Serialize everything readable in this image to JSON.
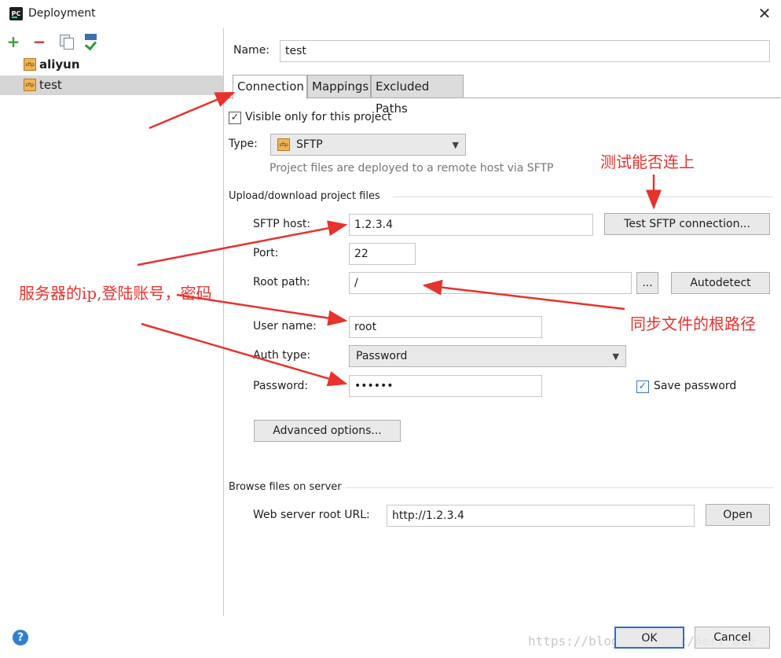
{
  "window": {
    "title": "Deployment",
    "close_glyph": "✕"
  },
  "toolbar": {
    "add_glyph": "+",
    "remove_glyph": "−"
  },
  "tree": {
    "items": [
      {
        "label": "aliyun",
        "icon_text": "sftp"
      },
      {
        "label": "test",
        "icon_text": "sftp"
      }
    ]
  },
  "form": {
    "name_label": "Name:",
    "name_value": "test",
    "tabs": [
      "Connection",
      "Mappings",
      "Excluded Paths"
    ],
    "visible_only": "Visible only for this project",
    "type_label": "Type:",
    "type_value": "SFTP",
    "type_hint": "Project files are deployed to a remote host via SFTP",
    "upload_section": "Upload/download project files",
    "host_label": "SFTP host:",
    "host_value": "1.2.3.4",
    "test_button": "Test SFTP connection...",
    "port_label": "Port:",
    "port_value": "22",
    "root_label": "Root path:",
    "root_value": "/",
    "browse_button": "...",
    "autodetect_button": "Autodetect",
    "user_label": "User name:",
    "user_value": "root",
    "auth_label": "Auth type:",
    "auth_value": "Password",
    "password_label": "Password:",
    "password_value": "••••••",
    "save_password": "Save password",
    "advanced_button": "Advanced options...",
    "browse_section": "Browse files on server",
    "web_url_label": "Web server root URL:",
    "web_url_value": "http://1.2.3.4",
    "open_button": "Open"
  },
  "footer": {
    "help": "?",
    "ok": "OK",
    "cancel": "Cancel",
    "watermark": "https://blog.csdn.net/Aeri_ale"
  },
  "annotations": {
    "test_connect": "测试能否连上",
    "server_info": "服务器的ip,登陆账号，密码",
    "root_path": "同步文件的根路径"
  },
  "colors": {
    "annotation": "#e8322d",
    "selection": "#d5d5d5",
    "accent": "#2c6fcb"
  }
}
